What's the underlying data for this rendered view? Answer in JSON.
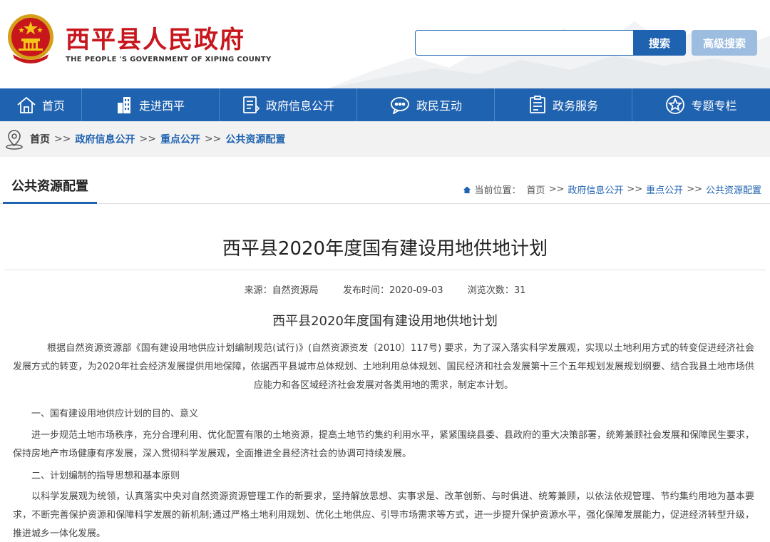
{
  "header": {
    "title": "西平县人民政府",
    "subtitle": "THE PEOPLE 'S GOVERNMENT OF XIPING COUNTY",
    "search_placeholder": "",
    "search_label": "搜索",
    "advanced_search_label": "高级搜索"
  },
  "nav": [
    {
      "label": "首页",
      "icon": "home-icon"
    },
    {
      "label": "走进西平",
      "icon": "building-icon"
    },
    {
      "label": "政府信息公开",
      "icon": "document-icon"
    },
    {
      "label": "政民互动",
      "icon": "chat-icon"
    },
    {
      "label": "政务服务",
      "icon": "service-icon"
    },
    {
      "label": "专题专栏",
      "icon": "star-icon"
    }
  ],
  "breadcrumb": {
    "home": "首页",
    "sep": ">>",
    "items": [
      "政府信息公开",
      "重点公开",
      "公共资源配置"
    ]
  },
  "section": {
    "title": "公共资源配置",
    "location_prefix": "当前位置：",
    "location_home": "首页",
    "location_items": [
      "政府信息公开",
      "重点公开",
      "公共资源配置"
    ],
    "sep": ">>"
  },
  "article": {
    "title": "西平县2020年度国有建设用地供地计划",
    "source_label": "来源：",
    "source": "自然资源局",
    "date_label": "发布时间：",
    "date": "2020-09-03",
    "views_label": "浏览次数：",
    "views": "31",
    "subtitle": "西平县2020年度国有建设用地供地计划",
    "p1": "根据自然资源资源部《国有建设用地供应计划编制规范(试行)》(自然资源资发〔2010〕117号) 要求，为了深入落实科学发展观，实现以土地利用方式的转变促进经济社会发展方式的转变，为2020年社会经济发展提供用地保障，依据西平县城市总体规划、土地利用总体规划、国民经济和社会发展第十三个五年规划发展规划纲要、结合我县土地市场供应能力和各区域经济社会发展对各类用地的需求，制定本计划。",
    "h1": "一、国有建设用地供应计划的目的、意义",
    "p2": "进一步规范土地市场秩序，充分合理利用、优化配置有限的土地资源，提高土地节约集约利用水平，紧紧围绕县委、县政府的重大决策部署，统筹兼顾社会发展和保障民生要求，保持房地产市场健康有序发展，深入贯彻科学发展观，全面推进全县经济社会的协调可持续发展。",
    "h2": "二、计划编制的指导思想和基本原则",
    "p3": "以科学发展观为统领，认真落实中央对自然资源资源管理工作的新要求，坚持解放思想、实事求是、改革创新、与时俱进、统筹兼顾，以依法依规管理、节约集约用地为基本要求，不断完善保护资源和保障科学发展的新机制;通过严格土地利用规划、优化土地供应、引导市场需求等方式，进一步提升保护资源水平，强化保障发展能力，促进经济转型升级，推进城乡一体化发展。"
  },
  "colors": {
    "brand_red": "#c8161d",
    "nav_blue": "#1f62b0",
    "link_blue": "#1f62b0"
  }
}
